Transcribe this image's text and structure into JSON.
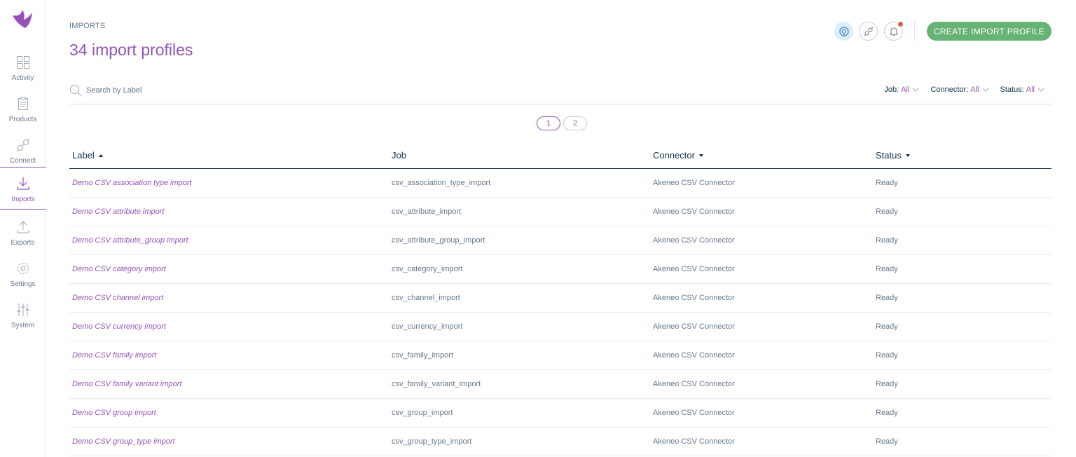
{
  "sidebar": {
    "items": [
      {
        "label": "Activity",
        "icon": "activity-grid-icon"
      },
      {
        "label": "Products",
        "icon": "clipboard-icon"
      },
      {
        "label": "Connect",
        "icon": "plug-icon"
      },
      {
        "label": "Imports",
        "icon": "download-icon",
        "active": true
      },
      {
        "label": "Exports",
        "icon": "upload-icon"
      },
      {
        "label": "Settings",
        "icon": "gear-icon"
      },
      {
        "label": "System",
        "icon": "sliders-icon"
      }
    ]
  },
  "header": {
    "breadcrumb": "IMPORTS",
    "title": "34 import profiles",
    "create_button": "CREATE IMPORT PROFILE"
  },
  "search": {
    "placeholder": "Search by Label"
  },
  "filters": [
    {
      "name": "Job",
      "value": "All"
    },
    {
      "name": "Connector",
      "value": "All"
    },
    {
      "name": "Status",
      "value": "All"
    }
  ],
  "pagination": {
    "pages": [
      "1",
      "2"
    ],
    "current": "1"
  },
  "table": {
    "columns": {
      "label": "Label",
      "job": "Job",
      "connector": "Connector",
      "status": "Status"
    },
    "rows": [
      {
        "label": "Demo CSV association type import",
        "job": "csv_association_type_import",
        "connector": "Akeneo CSV Connector",
        "status": "Ready"
      },
      {
        "label": "Demo CSV attribute import",
        "job": "csv_attribute_import",
        "connector": "Akeneo CSV Connector",
        "status": "Ready"
      },
      {
        "label": "Demo CSV attribute_group import",
        "job": "csv_attribute_group_import",
        "connector": "Akeneo CSV Connector",
        "status": "Ready"
      },
      {
        "label": "Demo CSV category import",
        "job": "csv_category_import",
        "connector": "Akeneo CSV Connector",
        "status": "Ready"
      },
      {
        "label": "Demo CSV channel import",
        "job": "csv_channel_import",
        "connector": "Akeneo CSV Connector",
        "status": "Ready"
      },
      {
        "label": "Demo CSV currency import",
        "job": "csv_currency_import",
        "connector": "Akeneo CSV Connector",
        "status": "Ready"
      },
      {
        "label": "Demo CSV family import",
        "job": "csv_family_import",
        "connector": "Akeneo CSV Connector",
        "status": "Ready"
      },
      {
        "label": "Demo CSV family variant import",
        "job": "csv_family_variant_import",
        "connector": "Akeneo CSV Connector",
        "status": "Ready"
      },
      {
        "label": "Demo CSV group import",
        "job": "csv_group_import",
        "connector": "Akeneo CSV Connector",
        "status": "Ready"
      },
      {
        "label": "Demo CSV group_type import",
        "job": "csv_group_type_import",
        "connector": "Akeneo CSV Connector",
        "status": "Ready"
      }
    ]
  },
  "colors": {
    "brand": "#9452ba",
    "create_button": "#67b373",
    "notification": "#d4604f",
    "text": "#67768a",
    "heading": "#11324d"
  }
}
